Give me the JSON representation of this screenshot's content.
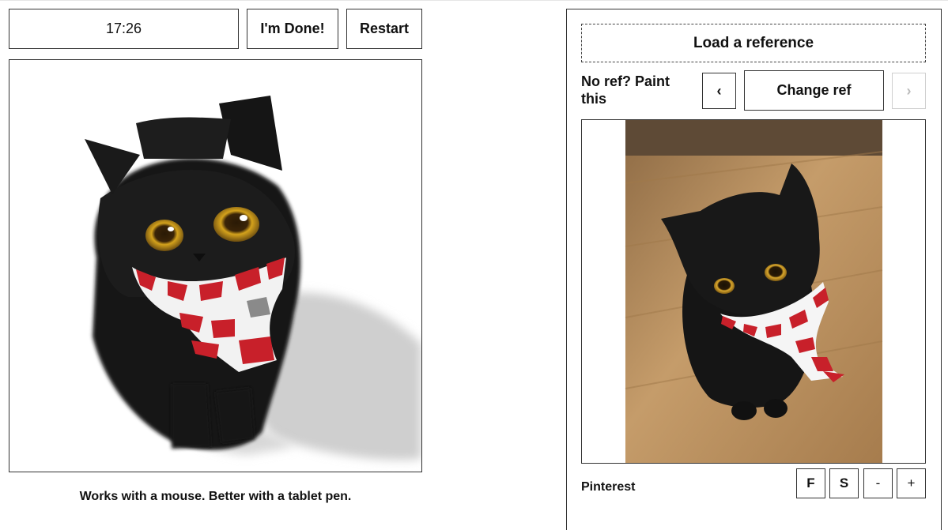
{
  "toolbar": {
    "timer": "17:26",
    "done_label": "I'm Done!",
    "restart_label": "Restart"
  },
  "canvas": {
    "hint": "Works with a mouse. Better with a tablet pen."
  },
  "reference": {
    "load_label": "Load a reference",
    "no_ref_text": "No ref? Paint this",
    "prev_label": "‹",
    "change_label": "Change ref",
    "next_label": "›",
    "credit": "Pinterest",
    "controls": {
      "f_label": "F",
      "s_label": "S",
      "minus_label": "-",
      "plus_label": "+"
    }
  },
  "colors": {
    "border": "#333333",
    "disabled": "#bbbbbb",
    "cat": "#141414",
    "scarf_red": "#c8202a",
    "floor": "#b98f5e",
    "eye": "#d4a21c"
  },
  "icons": {
    "prev": "chevron-left-icon",
    "next": "chevron-right-icon"
  }
}
